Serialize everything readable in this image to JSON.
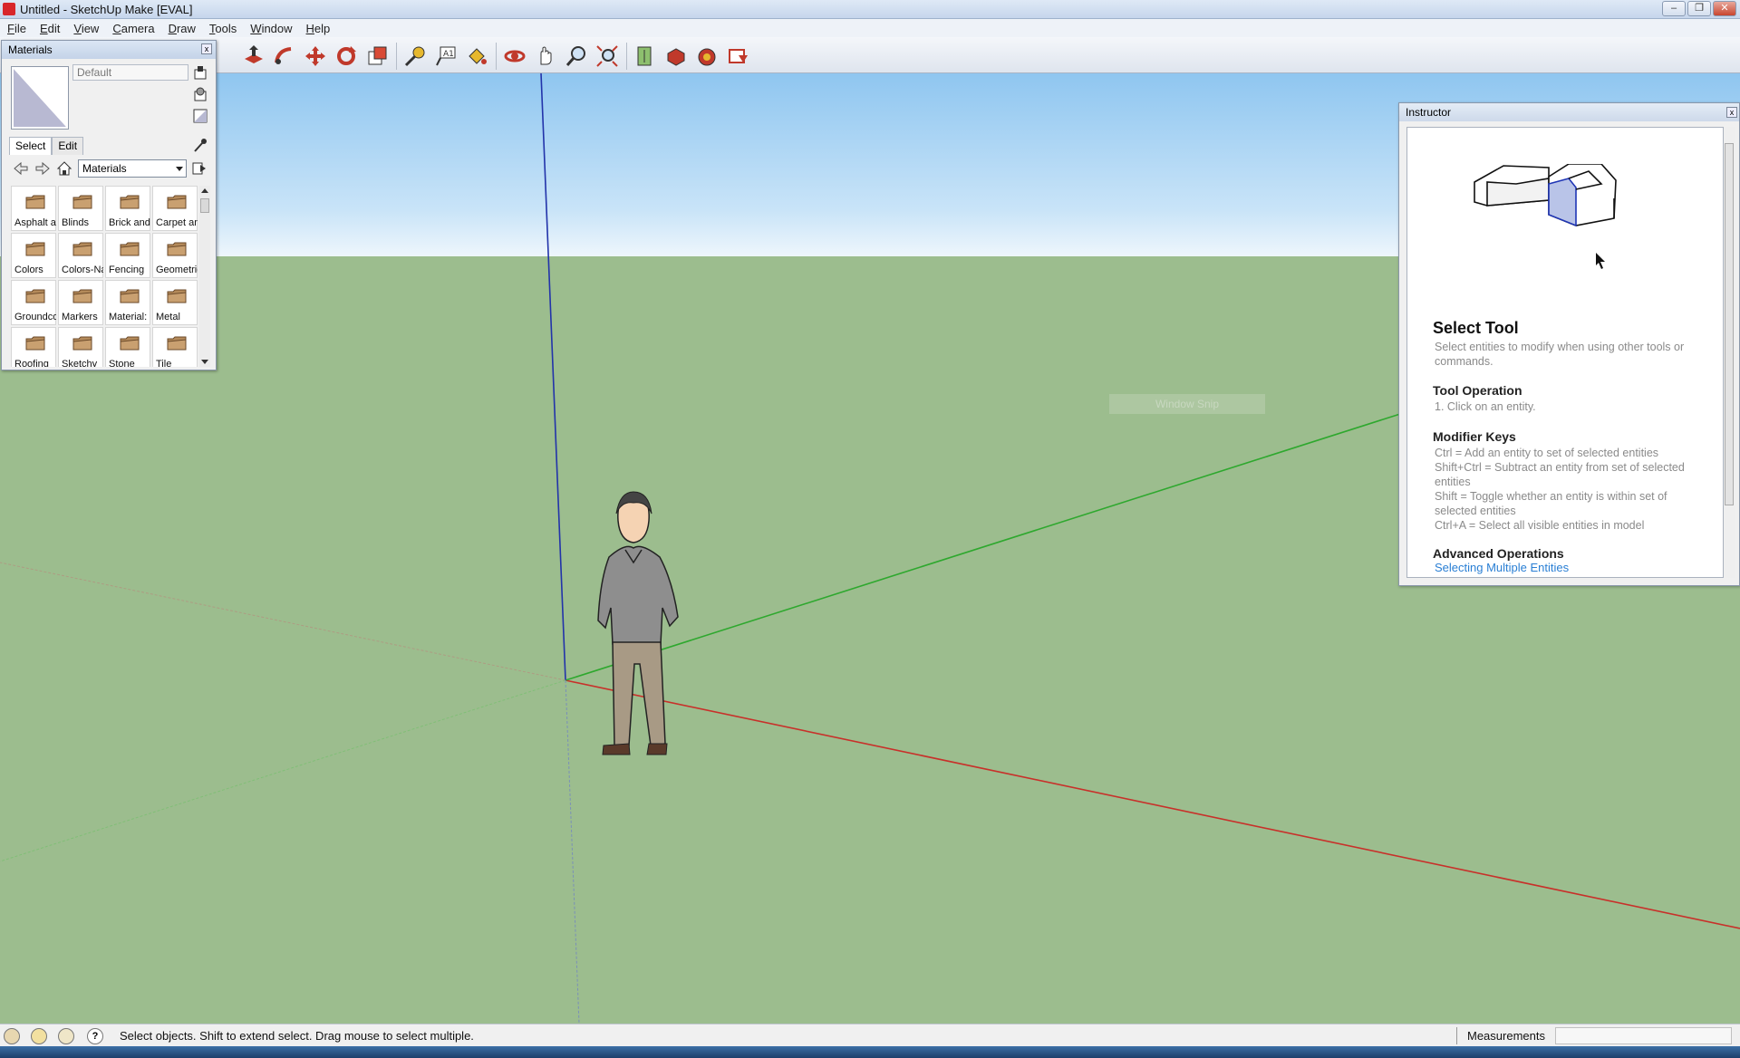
{
  "window": {
    "title": "Untitled - SketchUp Make [EVAL]",
    "buttons": [
      "–",
      "❐",
      "✕"
    ]
  },
  "menu": [
    "File",
    "Edit",
    "View",
    "Camera",
    "Draw",
    "Tools",
    "Window",
    "Help"
  ],
  "toolbar": {
    "icons": [
      "push-pull-icon",
      "follow-me-icon",
      "move-icon",
      "rotate-icon",
      "scale-icon",
      "tape-measure-icon",
      "text-icon",
      "paint-bucket-icon",
      "orbit-icon",
      "pan-icon",
      "zoom-icon",
      "zoom-extents-icon",
      "add-location-icon",
      "get-models-icon",
      "share-model-icon",
      "share-component-icon"
    ]
  },
  "materials": {
    "title": "Materials",
    "close": "x",
    "current_name": "Default",
    "tabs": [
      "Select",
      "Edit"
    ],
    "library": "Materials",
    "folders": [
      "Asphalt and",
      "Blinds",
      "Brick and",
      "Carpet and",
      "Colors",
      "Colors-Named",
      "Fencing",
      "Geometric",
      "Groundcover",
      "Markers",
      "Material: ",
      "Metal",
      "Roofing",
      "Sketchy",
      "Stone",
      "Tile"
    ]
  },
  "viewport": {
    "snip_label": "Window Snip",
    "colors": {
      "sky": "#a9d5f5",
      "ground": "#9cbd8e",
      "red_axis": "#c8302a",
      "green_axis": "#2ea82e",
      "blue_axis": "#2233aa"
    }
  },
  "instructor": {
    "title": "Instructor",
    "close": "x",
    "heading": "Select Tool",
    "description": "Select entities to modify when using other tools or commands.",
    "sections": {
      "operation_title": "Tool Operation",
      "operation_step": "1.   Click on an entity.",
      "modifier_title": "Modifier Keys",
      "modifiers": [
        "Ctrl = Add an entity to set of selected entities",
        "Shift+Ctrl = Subtract an entity from set of selected entities",
        "Shift = Toggle whether an entity is within set of selected entities",
        "Ctrl+A = Select all visible entities in model"
      ],
      "advanced_title": "Advanced Operations",
      "advanced_link": "Selecting Multiple Entities"
    }
  },
  "status": {
    "icons": [
      "geo-location-icon",
      "credits-icon",
      "user-icon",
      "help-icon"
    ],
    "help_glyph": "?",
    "text": "Select objects. Shift to extend select. Drag mouse to select multiple.",
    "measurements_label": "Measurements",
    "measurements_value": ""
  }
}
